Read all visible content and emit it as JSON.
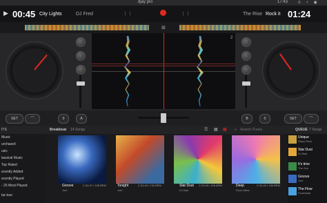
{
  "system_bar": {
    "app_name": "djay pro",
    "time": "17:43"
  },
  "deck_left": {
    "elapsed": "00:45",
    "title": "City Lights",
    "artist": "DJ Fred"
  },
  "deck_right": {
    "artist": "The Rise",
    "title": "Rock it",
    "elapsed": "01:24"
  },
  "deck_numbers": {
    "left": "1",
    "right": "2"
  },
  "controls": {
    "set_label": "SET",
    "left_pitch": "0",
    "right_pitch": "0",
    "left_mode": "A",
    "right_mode": "B"
  },
  "browser": {
    "sidebar_header": "ITS",
    "sidebar_items": [
      "Music",
      "urchased",
      "usic",
      "lassical Music",
      "Top Rated",
      "ecently Added",
      "ecently Played",
      "- 25 Most Played",
      "tar-tour"
    ],
    "playlist_title": "Breakbeat",
    "count": "14 Songs",
    "search_placeholder": "Search iTunes",
    "tiles": [
      {
        "title": "Groove",
        "artist": "Joel",
        "meta": "C 02:47 / 126 BPM"
      },
      {
        "title": "Tonight",
        "artist": "Joel",
        "meta": "C 02:43 / 132 BPM"
      },
      {
        "title": "Star Dust",
        "artist": "DJ Bart",
        "meta": "C 02:43 / 105 BPM"
      },
      {
        "title": "Deep",
        "artist": "Rock Miles",
        "meta": "C 02:43 / 130 BPM"
      }
    ]
  },
  "queue": {
    "header": "QUEUE",
    "count": "7 Songs",
    "items": [
      {
        "title": "Unique",
        "artist": "Stacy Rock"
      },
      {
        "title": "Star Dust",
        "artist": "DJ Bart"
      },
      {
        "title": "It's time",
        "artist": "The Sun"
      },
      {
        "title": "Groove",
        "artist": "Joel"
      },
      {
        "title": "The Flow",
        "artist": "Fourtetdar"
      }
    ]
  },
  "colors": {
    "accent": "#e3281e",
    "background": "#1b1b1d",
    "wave_blue": "#3a8ad0",
    "wave_gold": "#d8a23a"
  },
  "icons": [
    "list-icon",
    "grid-icon",
    "search-icon",
    "play-icon",
    "sync-icon"
  ]
}
